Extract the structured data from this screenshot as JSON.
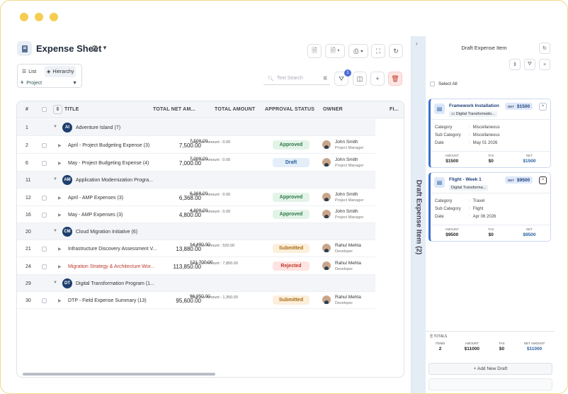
{
  "header": {
    "title": "Expense Sheet"
  },
  "view": {
    "list_label": "List",
    "hierarchy_label": "Hierarchy",
    "group_by": "Project"
  },
  "search": {
    "placeholder": "Text Search"
  },
  "filter_badge": "1",
  "table": {
    "columns": [
      "#",
      "TITLE",
      "TOTAL NET AM...",
      "TOTAL AMOUNT",
      "APPROVAL STATUS",
      "OWNER",
      "FI..."
    ],
    "groups": [
      {
        "num": "1",
        "initials": "AI",
        "name": "Adventure Island (7)"
      },
      {
        "num": "11",
        "initials": "AM",
        "name": "Application Modernization Progra..."
      },
      {
        "num": "20",
        "initials": "CM",
        "name": "Cloud Migration Initiative (6)"
      },
      {
        "num": "29",
        "initials": "DT",
        "name": "Digital Transformation Program (1..."
      }
    ],
    "rows": [
      {
        "num": "2",
        "title": "April - Project Budgeting Expense (3)",
        "net": "7,500.00",
        "total": "7,500.00",
        "tax": "Total Tax Amount : 0.00",
        "status": "Approved",
        "owner": "John Smith",
        "role": "Project Manager"
      },
      {
        "num": "6",
        "title": "May - Project Budgeting Expense (4)",
        "net": "7,000.00",
        "total": "7,000.00",
        "tax": "Total Tax Amount : 0.00",
        "status": "Draft",
        "owner": "John Smith",
        "role": "Project Manager"
      },
      {
        "num": "12",
        "title": "April - AMP Expenses (3)",
        "net": "6,368.00",
        "total": "6,368.00",
        "tax": "Total Tax Amount : 0.00",
        "status": "Approved",
        "owner": "John Smith",
        "role": "Project Manager"
      },
      {
        "num": "16",
        "title": "May - AMP Expenses (3)",
        "net": "4,800.00",
        "total": "4,800.00",
        "tax": "Total Tax Amount : 0.00",
        "status": "Approved",
        "owner": "John Smith",
        "role": "Project Manager"
      },
      {
        "num": "21",
        "title": "Infrastructure Discovery Assessment V...",
        "net": "13,880.00",
        "total": "14,400.00",
        "tax": "Total Tax Amount : 520.00",
        "status": "Submitted",
        "owner": "Rahul Mehta",
        "role": "Developer"
      },
      {
        "num": "24",
        "title": "Migration Strategy & Architecture Wor...",
        "net": "113,850.00",
        "total": "121,700.00",
        "tax": "Total Tax Amount : 7,850.00",
        "status": "Rejected",
        "owner": "Rahul Mehta",
        "role": "Developer"
      },
      {
        "num": "30",
        "title": "DTP - Field Expense Summary (13)",
        "net": "95,600.00",
        "total": "96,950.00",
        "tax": "Total Tax Amount : 1,350.00",
        "status": "Submitted",
        "owner": "Rahul Mehta",
        "role": "Developer"
      }
    ]
  },
  "panel": {
    "title": "Draft Expense Item",
    "vertical_title": "Draft Expense Item (2)",
    "select_all": "Select All",
    "cards": [
      {
        "name": "Framework Installation",
        "tag": "Digital Transformatio...",
        "net_label": "NET",
        "net": "$1500",
        "category": "Miscellaneous",
        "sub_category": "Miscellaneous",
        "date": "May 01 2026",
        "amount": "$1500",
        "tax": "$0",
        "netval": "$1500",
        "exp": "^"
      },
      {
        "name": "Flight - Week 1",
        "tag": "Digital Transforma...",
        "net_label": "NET",
        "net": "$9500",
        "category": "Travel",
        "sub_category": "Flight",
        "date": "Apr 06 2026",
        "amount": "$9500",
        "tax": "$0",
        "netval": "$9500",
        "exp": "^"
      }
    ],
    "labels": {
      "category": "Category",
      "sub_category": "Sub Category",
      "date": "Date",
      "amount": "AMOUNT",
      "tax": "TAX",
      "net": "NET"
    },
    "totals": {
      "label": "TOTALS",
      "items_label": "ITEMS",
      "items": "2",
      "amount_label": "AMOUNT",
      "amount": "$11000",
      "tax_label": "TAX",
      "tax": "$0",
      "net_label": "NET AMOUNT",
      "net": "$11000"
    },
    "add_label": "+ Add New Draft"
  }
}
